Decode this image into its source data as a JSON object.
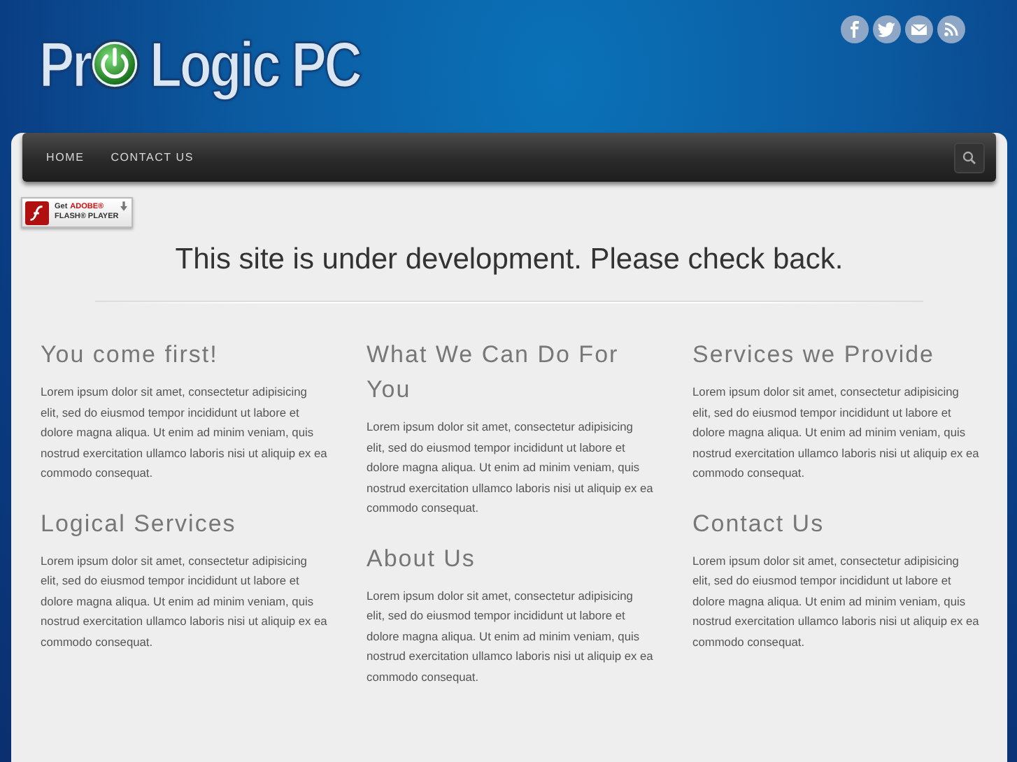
{
  "logo": {
    "before": "Pr",
    "after": "Logic PC"
  },
  "social": [
    {
      "kind": "facebook"
    },
    {
      "kind": "twitter"
    },
    {
      "kind": "mail"
    },
    {
      "kind": "rss"
    }
  ],
  "nav": {
    "items": [
      "HOME",
      "CONTACT US"
    ]
  },
  "flash_badge": {
    "get": "Get",
    "brand": "ADOBE®",
    "product": "FLASH® PLAYER"
  },
  "notice": "This site is under development. Please check back.",
  "columns": [
    [
      {
        "heading": "You come first!",
        "text": "Lorem ipsum dolor sit amet, consectetur adipisicing elit, sed do eiusmod tempor incididunt ut labore et dolore magna aliqua. Ut enim ad minim veniam, quis nostrud exercitation ullamco laboris nisi ut aliquip ex ea commodo consequat."
      },
      {
        "heading": "Logical Services",
        "text": "Lorem ipsum dolor sit amet, consectetur adipisicing elit, sed do eiusmod tempor incididunt ut labore et dolore magna aliqua. Ut enim ad minim veniam, quis nostrud exercitation ullamco laboris nisi ut aliquip ex ea commodo consequat."
      }
    ],
    [
      {
        "heading": "What We Can Do For You",
        "text": "Lorem ipsum dolor sit amet, consectetur adipisicing elit, sed do eiusmod tempor incididunt ut labore et dolore magna aliqua. Ut enim ad minim veniam, quis nostrud exercitation ullamco laboris nisi ut aliquip ex ea commodo consequat."
      },
      {
        "heading": "About Us",
        "text": "Lorem ipsum dolor sit amet, consectetur adipisicing elit, sed do eiusmod tempor incididunt ut labore et dolore magna aliqua. Ut enim ad minim veniam, quis nostrud exercitation ullamco laboris nisi ut aliquip ex ea commodo consequat."
      }
    ],
    [
      {
        "heading": "Services we Provide",
        "text": "Lorem ipsum dolor sit amet, consectetur adipisicing elit, sed do eiusmod tempor incididunt ut labore et dolore magna aliqua. Ut enim ad minim veniam, quis nostrud exercitation ullamco laboris nisi ut aliquip ex ea commodo consequat."
      },
      {
        "heading": "Contact Us",
        "text": "Lorem ipsum dolor sit amet, consectetur adipisicing elit, sed do eiusmod tempor incididunt ut labore et dolore magna aliqua. Ut enim ad minim veniam, quis nostrud exercitation ullamco laboris nisi ut aliquip ex ea commodo consequat."
      }
    ]
  ]
}
